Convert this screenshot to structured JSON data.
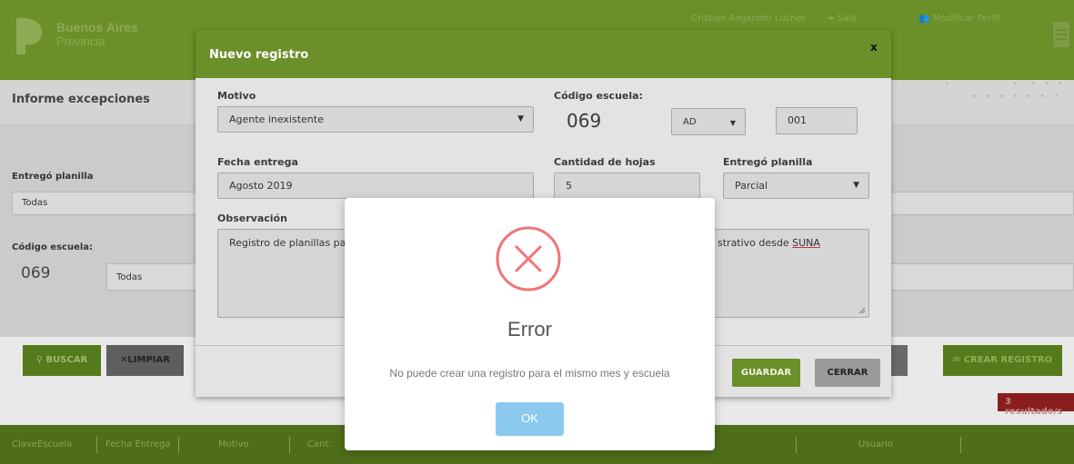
{
  "header": {
    "brand_line1": "Buenos Aires",
    "brand_line2": "Provincia",
    "user_name": "Cristian Alejandro Lucher",
    "logout_label": "Salir",
    "profile_label": "Modificar Perfil"
  },
  "page": {
    "title": "Informe excepciones",
    "filters": {
      "entrego_label": "Entregó planilla",
      "entrego_value": "Todas",
      "codigo_label": "Código escuela:",
      "codigo_number": "069",
      "codigo_select": "Todas"
    },
    "buttons": {
      "buscar": "BUSCAR",
      "limpiar": "LIMPIAR",
      "crear": "CREAR REGISTRO"
    },
    "results_badge": "3 resultado/s",
    "table_headers": [
      "ClaveEscuela",
      "Fecha Entrega",
      "Motivo",
      "Cant.",
      "Usuario"
    ]
  },
  "modal": {
    "title": "Nuevo registro",
    "close_label": "x",
    "motivo_label": "Motivo",
    "motivo_value": "Agente inexistente",
    "codigo_label": "Código escuela:",
    "codigo_number": "069",
    "codigo_type": "AD",
    "codigo_suffix": "001",
    "fecha_label": "Fecha entrega",
    "fecha_value": "Agosto 2019",
    "hojas_label": "Cantidad de hojas",
    "hojas_value": "5",
    "entrego_label": "Entregó planilla",
    "entrego_value": "Parcial",
    "observacion_label": "Observación",
    "observacion_left": "Registro de planillas pap",
    "observacion_right_pre": "strativo desde ",
    "observacion_right_word": "SUNA",
    "guardar_label": "GUARDAR",
    "cerrar_label": "CERRAR"
  },
  "alert": {
    "icon": "error-x-circle-icon",
    "title": "Error",
    "message": "No puede crear una registro para el mismo mes y escuela",
    "ok_label": "OK"
  },
  "colors": {
    "brand_green": "#6b8f29",
    "error_red": "#f27474",
    "ok_blue": "#8bc9ef",
    "badge_red": "#8a1e1e"
  }
}
